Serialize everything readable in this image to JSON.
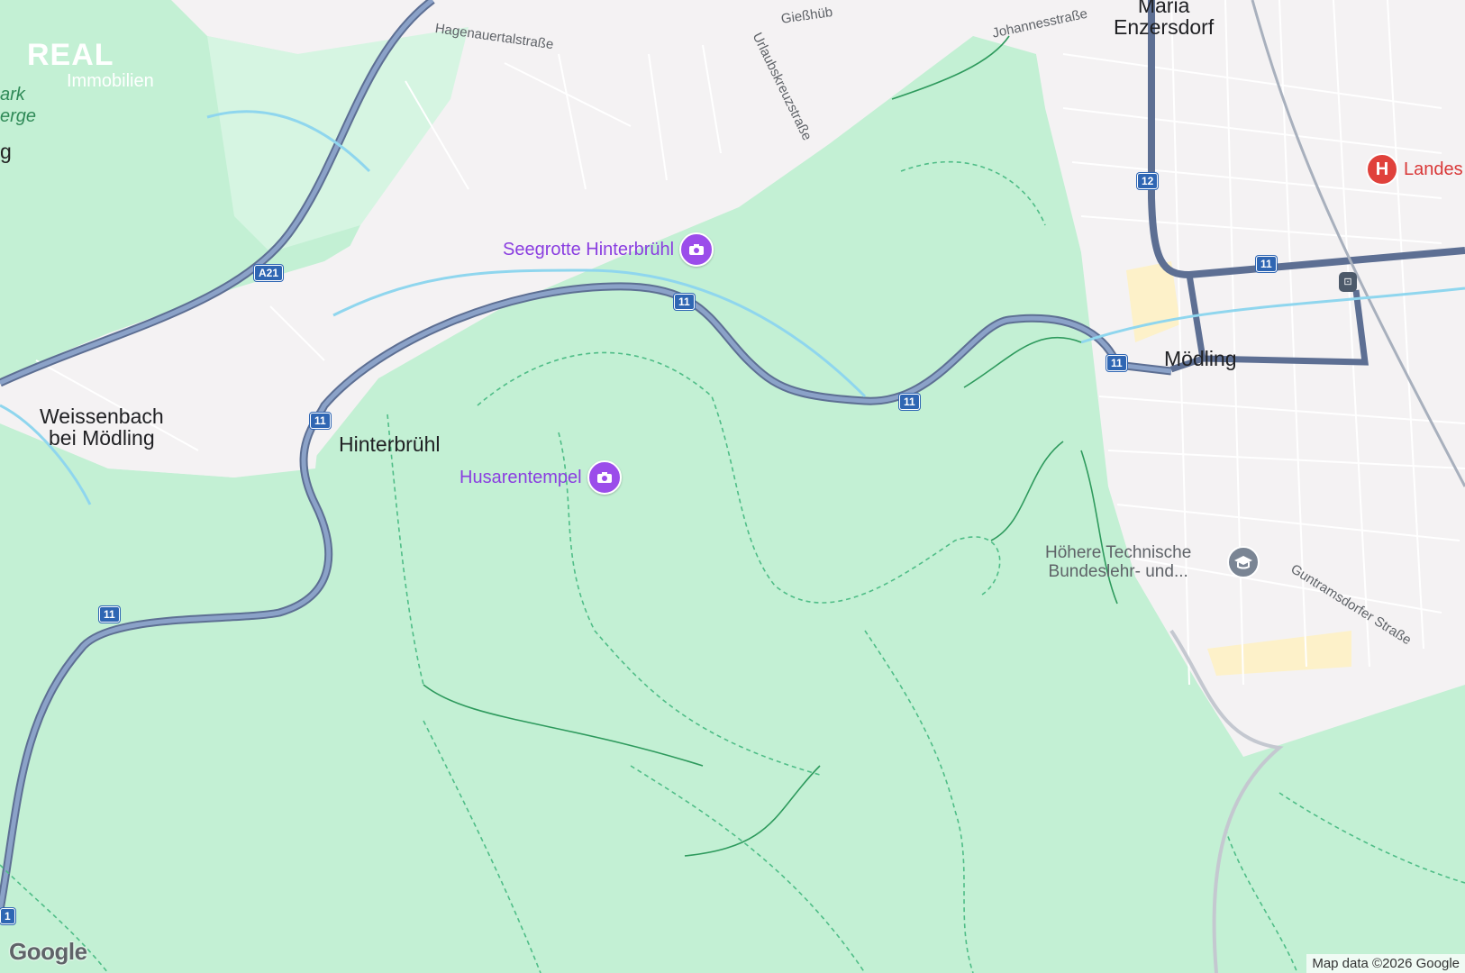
{
  "logo": {
    "brand": "REAL",
    "sub": "Immobilien"
  },
  "map": {
    "colors": {
      "forest": "#c3f0d4",
      "urban": "#f4f2f3",
      "road": "#7b8fb0",
      "water": "#8fd6ee"
    },
    "towns": {
      "maria_enzersdorf": [
        "Maria",
        "Enzersdorf"
      ],
      "weissenbach": [
        "Weissenbach",
        "bei Mödling"
      ],
      "hinterbruehl": "Hinterbrühl",
      "moedling": "Mödling"
    },
    "pois": {
      "seegrotte": "Seegrotte Hinterbrühl",
      "husarentempel": "Husarentempel",
      "hospital": "Landes",
      "school": [
        "Höhere Technische",
        "Bundeslehr- und..."
      ]
    },
    "streets": {
      "hagenauertal": "Hagenauertalstraße",
      "giesshuebler": "Gießhüb",
      "johannes": "Johannesstraße",
      "urlaubskreuz": "Urlaubskreuzstraße",
      "guntramsdorfer": "Guntramsdorfer Straße"
    },
    "edge_labels": {
      "park": "ark",
      "berge": "erge",
      "g": "g"
    },
    "shields": {
      "a21": "A21",
      "r11": "11",
      "r12": "12",
      "r1": "1"
    }
  },
  "footer": {
    "google": "Google",
    "attribution": "Map data ©2026 Google"
  }
}
